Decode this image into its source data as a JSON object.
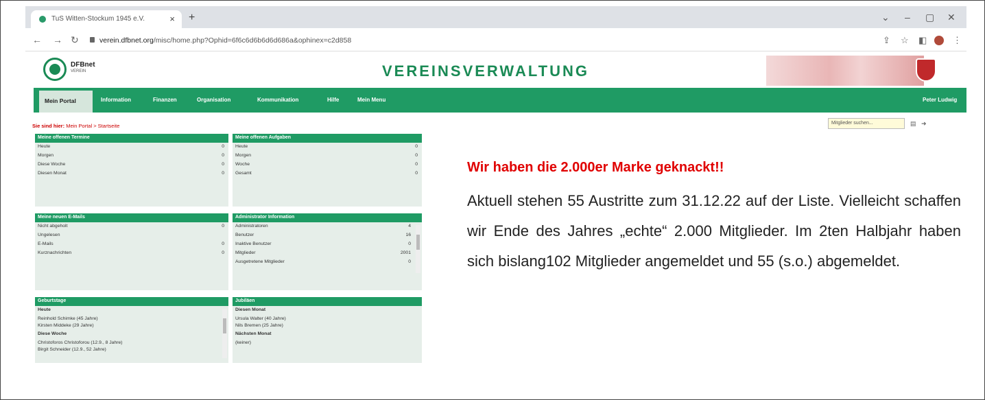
{
  "browser": {
    "tab_title": "TuS Witten-Stockum 1945 e.V.",
    "url_host": "verein.dfbnet.org",
    "url_path": "/misc/home.php?Ophid=6f6c6d6b6d6d686a&ophinex=c2d858"
  },
  "app": {
    "brand_name": "DFBnet",
    "brand_sub": "VEREIN",
    "title": "VEREINSVERWALTUNG",
    "user": "Peter Ludwig"
  },
  "menu": {
    "active": "Mein Portal",
    "items": [
      "Information",
      "Finanzen",
      "Organisation",
      "Kommunikation",
      "Hilfe",
      "Mein Menu"
    ]
  },
  "breadcrumb": {
    "prefix": "Sie sind hier:",
    "path": "Mein Portal > Startseite"
  },
  "search": {
    "placeholder": "Mitglieder suchen..."
  },
  "panels": {
    "termine": {
      "title": "Meine offenen Termine",
      "rows": [
        {
          "label": "Heute",
          "value": "0"
        },
        {
          "label": "Morgen",
          "value": "0"
        },
        {
          "label": "Diese Woche",
          "value": "0"
        },
        {
          "label": "Diesen Monat",
          "value": "0"
        }
      ]
    },
    "aufgaben": {
      "title": "Meine offenen Aufgaben",
      "rows": [
        {
          "label": "Heute",
          "value": "0"
        },
        {
          "label": "Morgen",
          "value": "0"
        },
        {
          "label": "Woche",
          "value": "0"
        },
        {
          "label": "Gesamt",
          "value": "0"
        }
      ]
    },
    "emails": {
      "title": "Meine neuen E-Mails",
      "rows": [
        {
          "label": "Nicht abgeholt",
          "value": "0"
        },
        {
          "label": "Ungelesen",
          "value": ""
        },
        {
          "label": "E-Mails",
          "value": "0"
        },
        {
          "label": "Kurznachrichten",
          "value": "0"
        }
      ]
    },
    "admin": {
      "title": "Administrator Information",
      "rows": [
        {
          "label": "Administratoren",
          "value": "4"
        },
        {
          "label": "Benutzer",
          "value": "16"
        },
        {
          "label": "Inaktive Benutzer",
          "value": "0"
        },
        {
          "label": "Mitglieder",
          "value": "2001"
        },
        {
          "label": "Ausgetretene Mitglieder",
          "value": "0"
        }
      ]
    },
    "geburtstage": {
      "title": "Geburtstage",
      "heading1": "Heute",
      "today": [
        "Reinhold Schimke (45 Jahre)",
        "Kirsten Middeke (29 Jahre)"
      ],
      "heading2": "Diese Woche",
      "week": [
        "Christoforos Christoforou (12.9., 8 Jahre)",
        "Birgit Schneider (12.9., 52 Jahre)"
      ]
    },
    "jubilaeen": {
      "title": "Jubiläen",
      "heading1": "Diesen Monat",
      "month": [
        "Ursula Walter (40 Jahre)",
        "Nils Bremen (25 Jahre)"
      ],
      "heading2": "Nächsten Monat",
      "next": [
        "(keiner)"
      ]
    }
  },
  "announcement": {
    "headline": "Wir haben die 2.000er Marke geknackt!!",
    "body": "Aktuell stehen 55 Austritte zum 31.12.22 auf der Liste. Vielleicht schaffen wir Ende des Jahres „echte“ 2.000 Mitglieder. Im 2ten Halbjahr haben sich bislang102 Mitglieder angemeldet und 55 (s.o.) abgemeldet."
  },
  "colors": {
    "dfb_green": "#1f9b64",
    "headline_red": "#e00000"
  }
}
